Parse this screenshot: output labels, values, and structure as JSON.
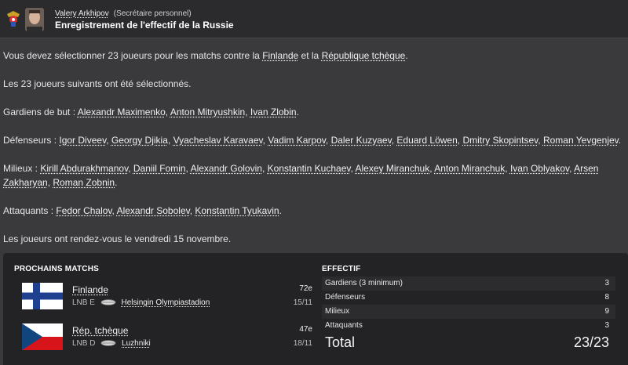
{
  "header": {
    "sender_name": "Valery Arkhipov",
    "sender_role": "(Secrétaire personnel)",
    "subject": "Enregistrement de l'effectif de la Russie"
  },
  "message": {
    "p1": [
      "Vous devez sélectionner 23 joueurs pour les matchs contre la ",
      "Finlande",
      " et la ",
      "République tchèque",
      "."
    ],
    "p2": "Les 23 joueurs suivants ont été sélectionnés.",
    "goalkeepers_label": "Gardiens de but : ",
    "goalkeepers": [
      "Alexandr Maximenko",
      "Anton Mitryushkin",
      "Ivan Zlobin"
    ],
    "defenders_label": "Défenseurs : ",
    "defenders": [
      "Igor Diveev",
      "Georgy Djikia",
      "Vyacheslav Karavaev",
      "Vadim Karpov",
      "Daler Kuzyaev",
      "Eduard Löwen",
      "Dmitry Skopintsev",
      "Roman Yevgenjev"
    ],
    "midfielders_label": "Milieux : ",
    "midfielders": [
      "Kirill Abdurakhmanov",
      "Daniil Fomin",
      "Alexandr Golovin",
      "Konstantin Kuchaev",
      "Alexey Miranchuk",
      "Anton Miranchuk",
      "Ivan Oblyakov",
      "Arsen Zakharyan",
      "Roman Zobnin"
    ],
    "attackers_label": "Attaquants : ",
    "attackers": [
      "Fedor Chalov",
      "Alexandr Sobolev",
      "Konstantin Tyukavin"
    ],
    "closing": "Les joueurs ont rendez-vous le vendredi 15 novembre."
  },
  "next_matches": {
    "title": "PROCHAINS MATCHS",
    "matches": [
      {
        "opponent": "Finlande",
        "competition": "LNB",
        "venue_type": "E",
        "stadium": "Helsingin Olympiastadion",
        "rank": "72e",
        "date": "15/11"
      },
      {
        "opponent": "Rép. tchèque",
        "competition": "LNB",
        "venue_type": "D",
        "stadium": "Luzhniki",
        "rank": "47e",
        "date": "18/11"
      }
    ]
  },
  "squad": {
    "title": "EFFECTIF",
    "rows": [
      {
        "label": "Gardiens (3 minimum)",
        "value": "3"
      },
      {
        "label": "Défenseurs",
        "value": "8"
      },
      {
        "label": "Milieux",
        "value": "9"
      },
      {
        "label": "Attaquants",
        "value": "3"
      }
    ],
    "total_label": "Total",
    "total_value": "23/23"
  },
  "icons": {
    "crest": "russia-football-crest-icon",
    "ball": "football-icon"
  },
  "colors": {
    "background": "#3a3a3d",
    "panel": "#232325",
    "finland_blue": "#1f3f8f",
    "czech_red": "#d7141a",
    "czech_blue": "#11457e"
  }
}
